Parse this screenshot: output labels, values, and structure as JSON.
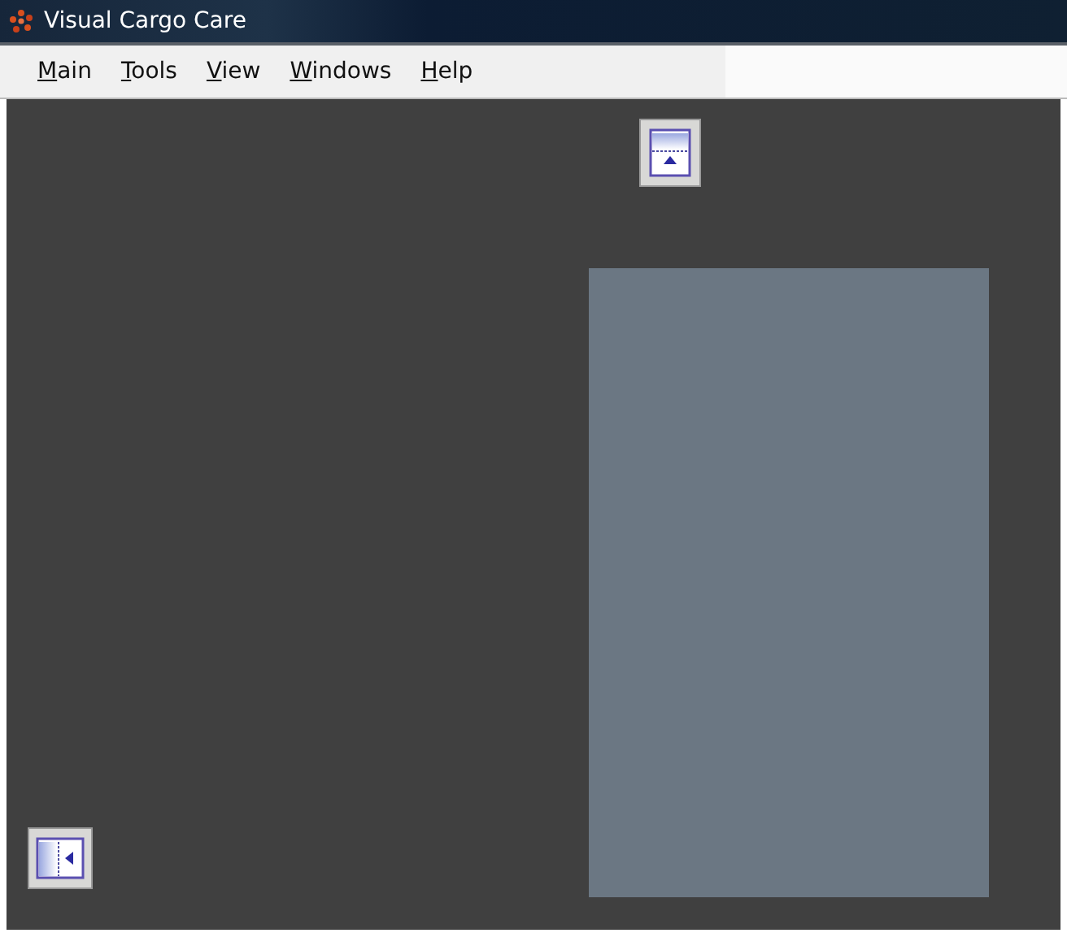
{
  "window": {
    "title": "Visual Cargo Care"
  },
  "menu": [
    "Main",
    "Tools",
    "View",
    "Windows",
    "Help"
  ]
}
